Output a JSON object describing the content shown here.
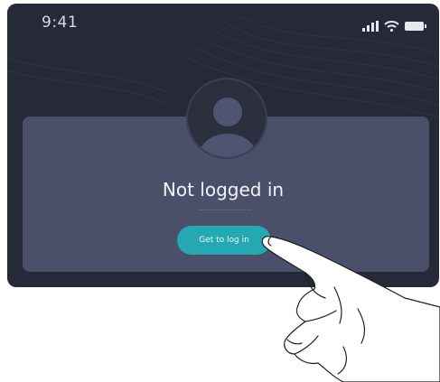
{
  "status_bar": {
    "time": "9:41",
    "icons": [
      "signal-icon",
      "wifi-icon",
      "battery-icon"
    ]
  },
  "profile": {
    "avatar_icon": "user-avatar-icon",
    "title": "Not logged in",
    "login_button_label": "Get to log in"
  },
  "colors": {
    "background": "#262a38",
    "card": "#4a5069",
    "accent": "#26a8b2",
    "text": "#f2f3f7"
  }
}
